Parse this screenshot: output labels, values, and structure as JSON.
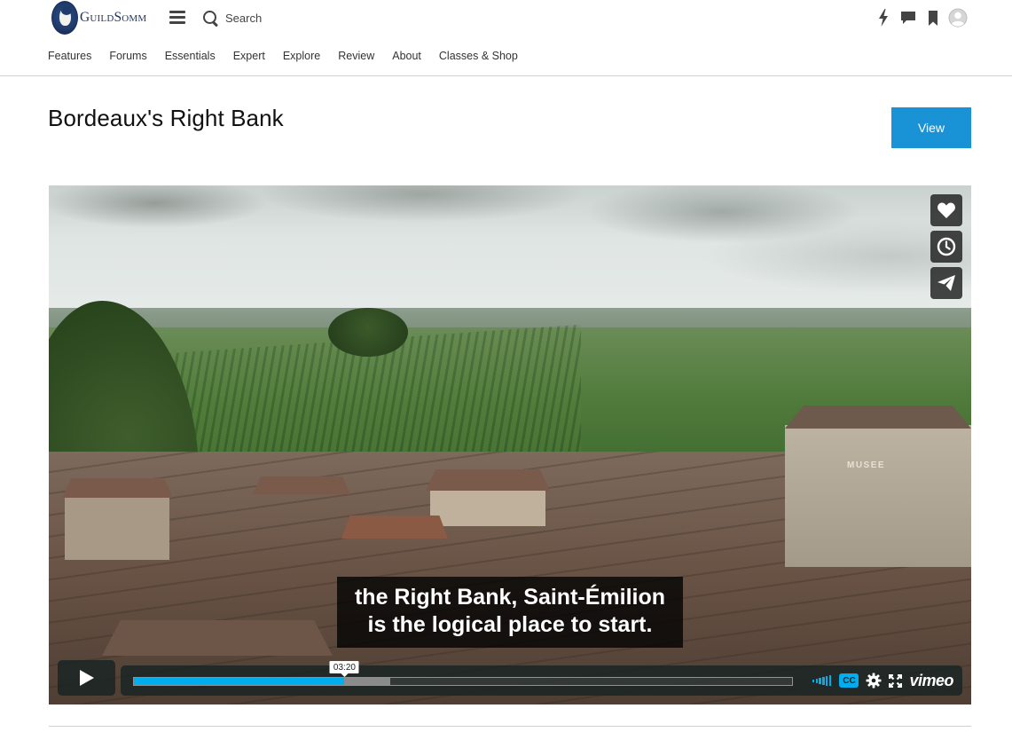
{
  "header": {
    "brand": "GuildSomm",
    "search_label": "Search",
    "icons": [
      "lightning-icon",
      "chat-icon",
      "bookmark-icon",
      "user-avatar-icon"
    ]
  },
  "nav": {
    "items": [
      "Features",
      "Forums",
      "Essentials",
      "Expert",
      "Explore",
      "Review",
      "About",
      "Classes & Shop"
    ]
  },
  "page": {
    "title": "Bordeaux's Right Bank",
    "view_label": "View"
  },
  "video": {
    "caption_line1": "the Right Bank, Saint-Émilion",
    "caption_line2": "is the logical place to start.",
    "hover_time": "03:20",
    "progress_played_pct": 32,
    "progress_loaded_pct": 39,
    "cc_label": "CC",
    "player_brand": "vimeo",
    "scene_sign": "MUSEE",
    "side_actions": [
      "like-icon",
      "watch-later-icon",
      "share-icon"
    ]
  },
  "colors": {
    "accent": "#1a93d6",
    "player_accent": "#00adef",
    "brand_navy": "#1e335e"
  }
}
